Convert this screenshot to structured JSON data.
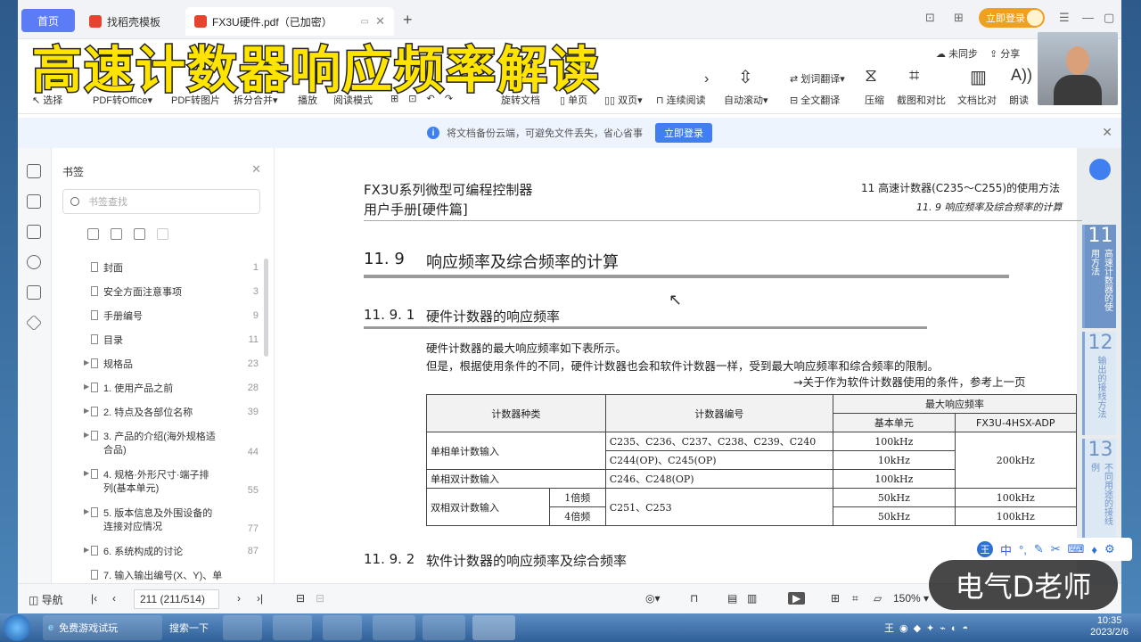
{
  "overlay": {
    "title": "高速计数器响应频率解读",
    "watermark": "电气D老师"
  },
  "titlebar": {
    "tabs": [
      {
        "label": "首页"
      },
      {
        "label": "找稻壳模板"
      },
      {
        "label": "FX3U硬件.pdf（已加密）"
      }
    ],
    "login": "立即登录"
  },
  "toolbar": {
    "row_labels": [
      "选择",
      "PDF转Office",
      "PDF转图片",
      "拆分合并",
      "播放",
      "阅读模式",
      "旋转文档",
      "单页",
      "双页",
      "连续阅读",
      "自动滚动"
    ],
    "right_labels": [
      "划词翻译",
      "全文翻译",
      "压缩",
      "截图和对比",
      "文档比对",
      "朗读"
    ],
    "sync": "未同步",
    "share": "分享"
  },
  "notice": {
    "text": "将文档备份云端，可避免文件丢失，省心省事",
    "button": "立即登录"
  },
  "bookmarks": {
    "title": "书签",
    "search_placeholder": "书签查找",
    "items": [
      {
        "label": "封面",
        "page": "1"
      },
      {
        "label": "安全方面注意事项",
        "page": "3"
      },
      {
        "label": "手册编号",
        "page": "9"
      },
      {
        "label": "目录",
        "page": "11"
      },
      {
        "label": "规格品",
        "page": "23"
      },
      {
        "label": "1. 使用产品之前",
        "page": "28"
      },
      {
        "label": "2. 特点及各部位名称",
        "page": "39"
      },
      {
        "label": "3. 产品的介绍(海外规格适合品)",
        "page": "44"
      },
      {
        "label": "4. 规格·外形尺寸·端子排列(基本单元)",
        "page": "55"
      },
      {
        "label": "5. 版本信息及外围设备的连接对应情况",
        "page": "77"
      },
      {
        "label": "6. 系统构成的讨论",
        "page": "87"
      },
      {
        "label": "7. 输入输出编号(X、Y)、单",
        "page": ""
      }
    ]
  },
  "doc": {
    "header_left_1": "FX3U系列微型可编程控制器",
    "header_left_2": "用户手册[硬件篇]",
    "header_right_1": "11  高速计数器(C235～C255)的使用方法",
    "header_right_2": "11. 9  响应频率及综合频率的计算",
    "sec_num": "11. 9",
    "sec_title": "响应频率及综合频率的计算",
    "sub1_num": "11. 9. 1",
    "sub1_title": "硬件计数器的响应频率",
    "para1": "硬件计数器的最大响应频率如下表所示。",
    "para2": "但是，根据使用条件的不同，硬件计数器也会和软件计数器一样，受到最大响应频率和综合频率的限制。",
    "para3": "→关于作为软件计数器使用的条件，参考上一页",
    "sub2_num": "11. 9. 2",
    "sub2_title": "软件计数器的响应频率及综合频率",
    "table": {
      "h_type": "计数器种类",
      "h_no": "计数器编号",
      "h_max": "最大响应频率",
      "h_base": "基本单元",
      "h_adp": "FX3U-4HSX-ADP",
      "r1_type": "单相单计数输入",
      "r1a_no": "C235、C236、C237、C238、C239、C240",
      "r1a_base": "100kHz",
      "r1b_no": "C244(OP)、C245(OP)",
      "r1b_base": "10kHz",
      "r1_adp": "200kHz",
      "r2_type": "单相双计数输入",
      "r2_no": "C246、C248(OP)",
      "r2_base": "100kHz",
      "r3_type": "双相双计数输入",
      "r3a_mult": "1倍频",
      "r3b_mult": "4倍频",
      "r3_no": "C251、C253",
      "r3a_base": "50kHz",
      "r3a_adp": "100kHz",
      "r3b_base": "50kHz",
      "r3b_adp": "100kHz"
    },
    "chapter_tabs": [
      {
        "num": "11",
        "label": "高速计数器的使用方法"
      },
      {
        "num": "12",
        "label": "输出的接线方法"
      },
      {
        "num": "13",
        "label": "不同用途的接线例"
      }
    ]
  },
  "status": {
    "nav": "导航",
    "page": "211 (211/514)",
    "zoom": "150%"
  },
  "taskbar": {
    "ie_label": "免费游戏试玩",
    "search_label": "搜索一下",
    "time": "10:35",
    "date": "2023/2/6"
  },
  "ime": {
    "lang": "中"
  }
}
